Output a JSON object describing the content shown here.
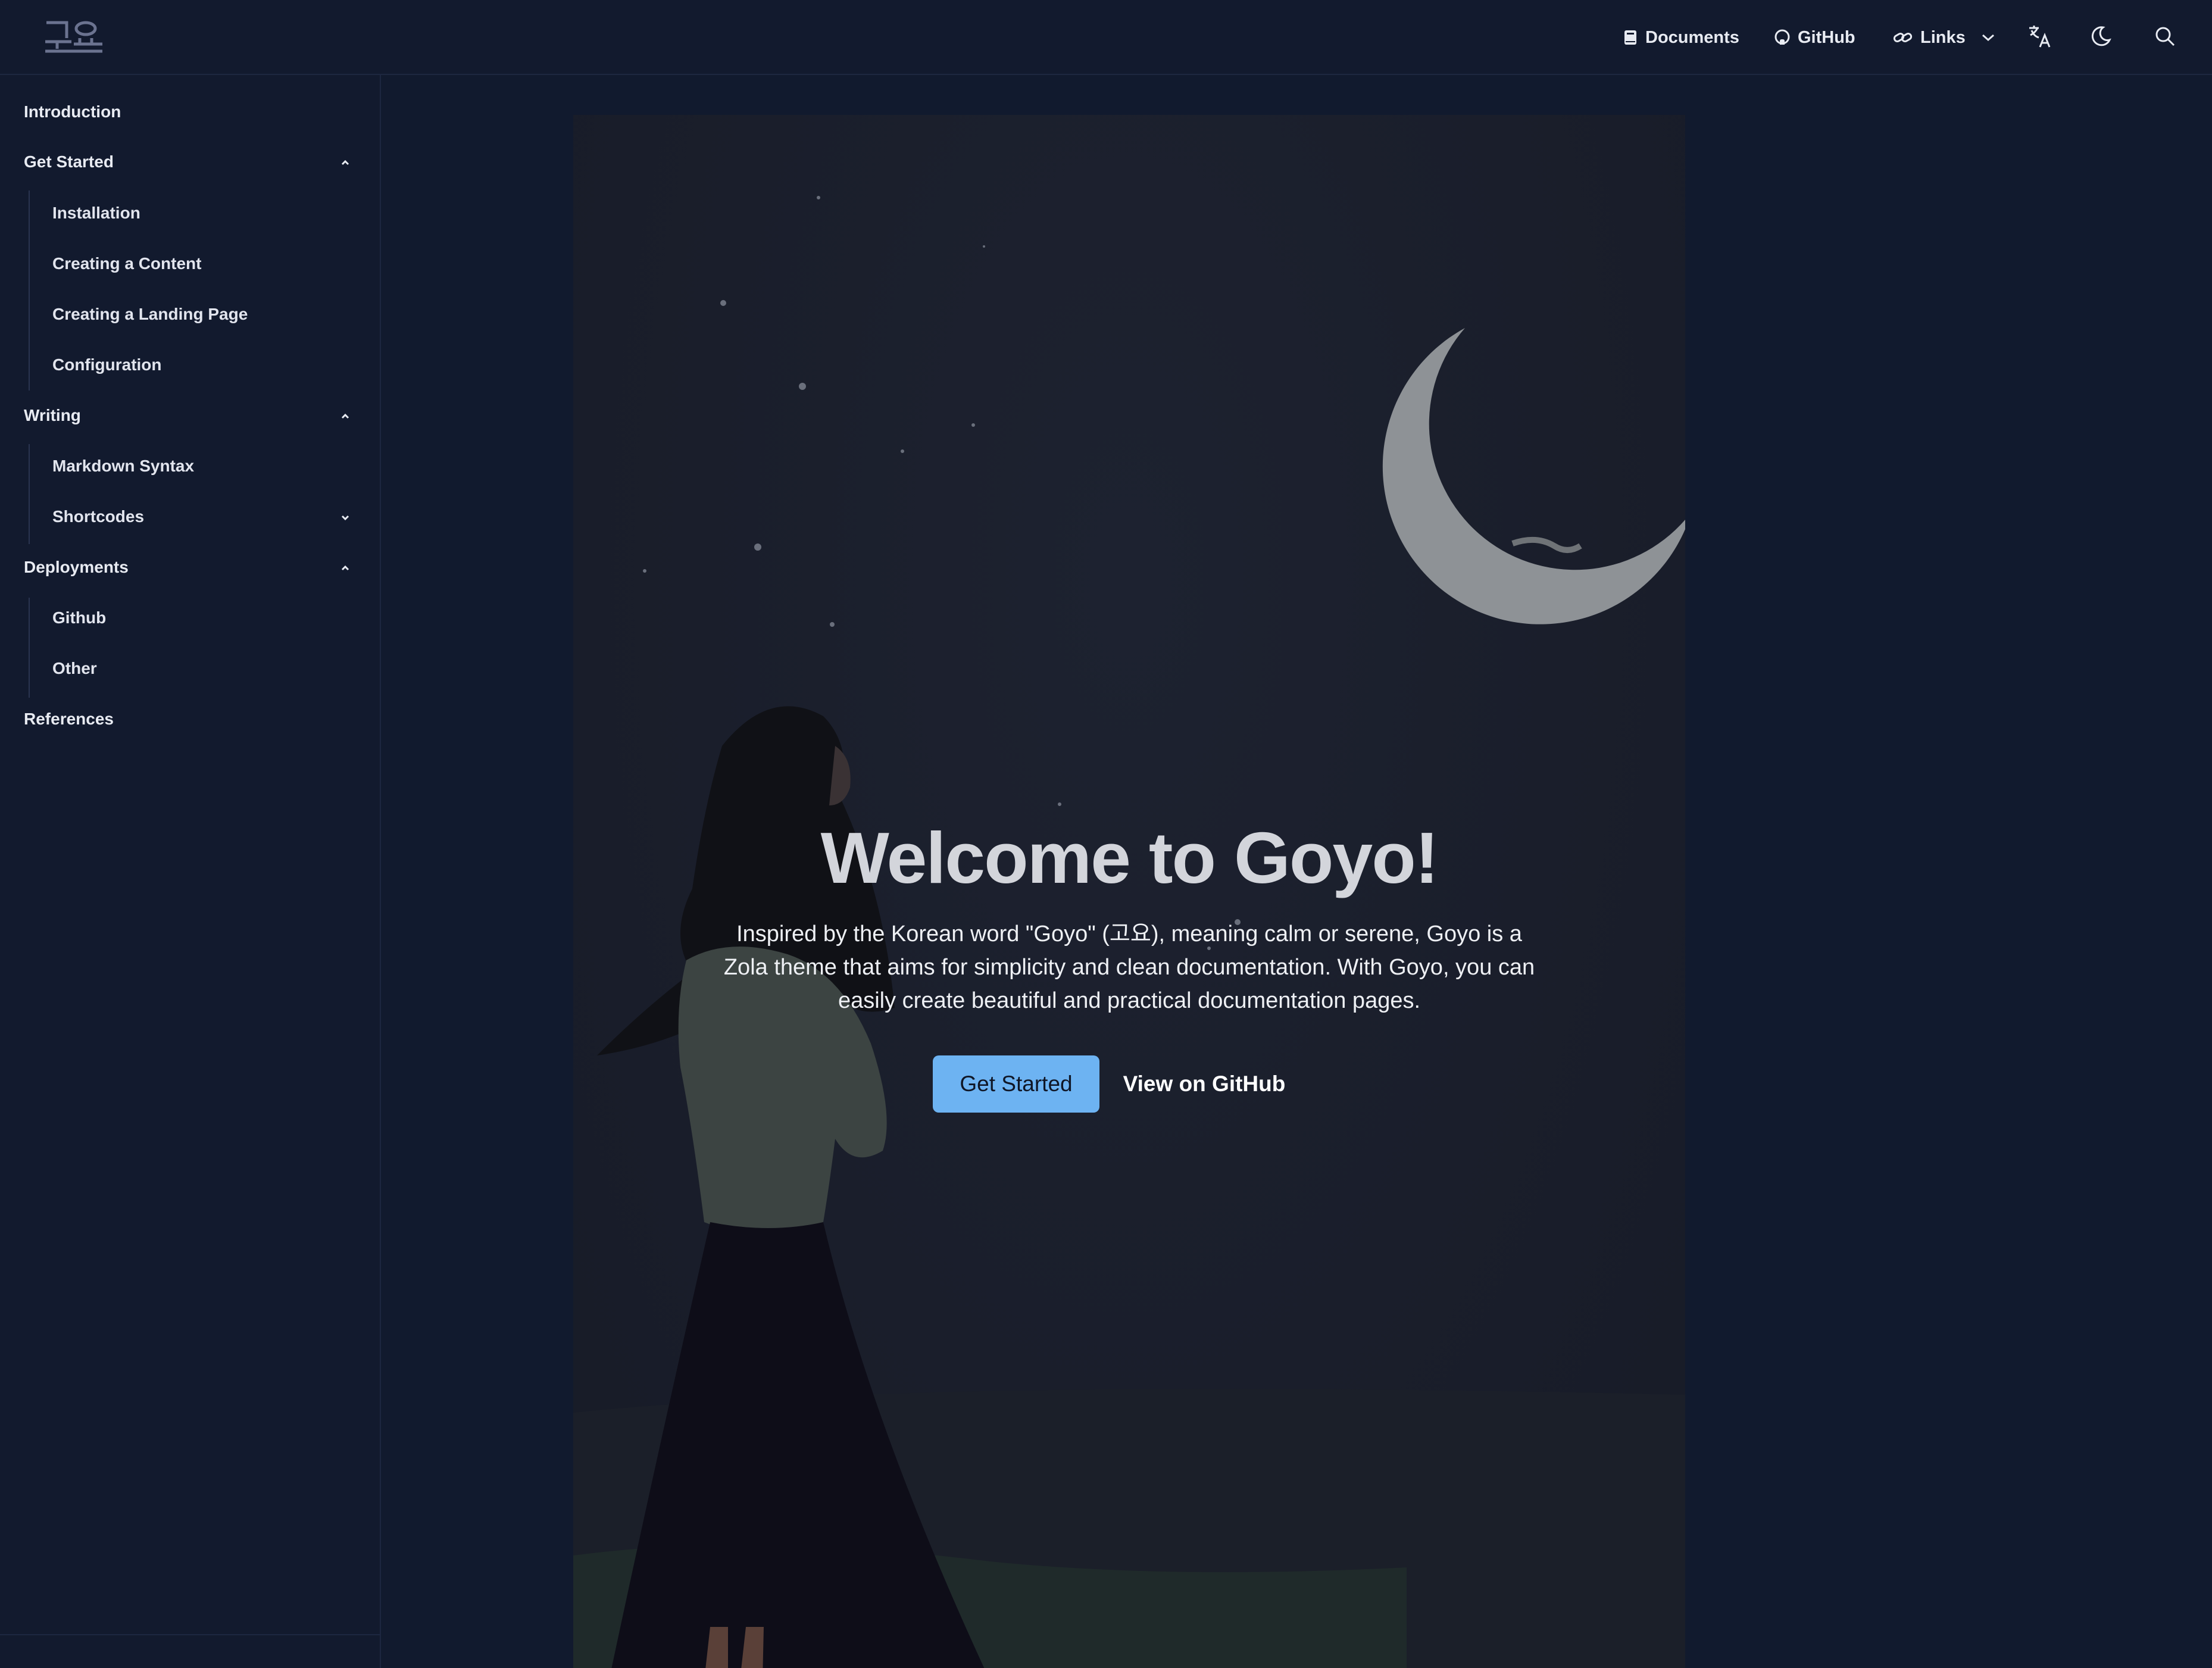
{
  "header": {
    "logo_text": "고요",
    "nav": {
      "documents": "Documents",
      "github": "GitHub",
      "links": "Links"
    },
    "icons": [
      "book-icon",
      "github-icon",
      "link-icon",
      "chevron-down-icon",
      "translate-icon",
      "moon-icon",
      "search-icon"
    ]
  },
  "sidebar": {
    "items": [
      {
        "label": "Introduction"
      },
      {
        "label": "Get Started",
        "expanded": true
      },
      {
        "label": "Installation"
      },
      {
        "label": "Creating a Content"
      },
      {
        "label": "Creating a Landing Page"
      },
      {
        "label": "Configuration"
      },
      {
        "label": "Writing",
        "expanded": true
      },
      {
        "label": "Markdown Syntax"
      },
      {
        "label": "Shortcodes",
        "expanded": false
      },
      {
        "label": "Deployments",
        "expanded": true
      },
      {
        "label": "Github"
      },
      {
        "label": "Other"
      },
      {
        "label": "References"
      }
    ]
  },
  "hero": {
    "title": "Welcome to Goyo!",
    "description": "Inspired by the Korean word \"Goyo\" (고요), meaning calm or serene, Goyo is a Zola theme that aims for simplicity and clean documentation. With Goyo, you can easily create beautiful and practical documentation pages.",
    "primary_button": "Get Started",
    "secondary_button": "View on GitHub"
  },
  "colors": {
    "background": "#111a2e",
    "accent": "#6db3f2",
    "hero_background": "#1a1e2b"
  }
}
